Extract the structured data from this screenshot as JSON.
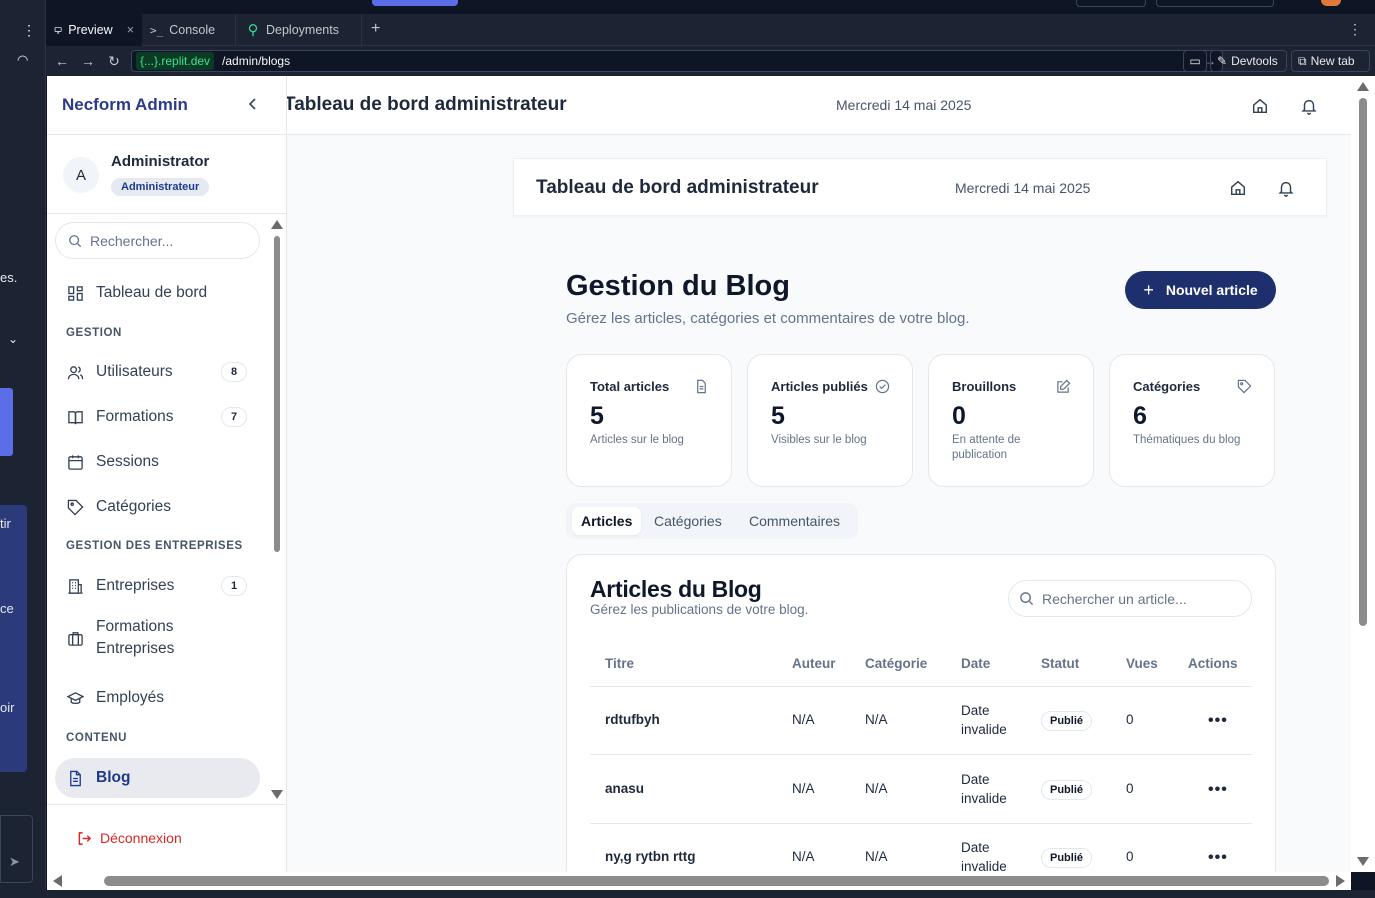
{
  "host": {
    "tabs": [
      {
        "label": "Preview",
        "icon": "monitor-icon"
      },
      {
        "label": "Console",
        "icon": "terminal-icon"
      },
      {
        "label": "Deployments",
        "icon": "deployments-icon"
      }
    ],
    "url_domain": "{...}.replit.dev",
    "url_path": "/admin/blogs",
    "devtools_label": "Devtools",
    "newtab_label": "New tab",
    "left_fragments": [
      "es.",
      "tir",
      "ce",
      "oir"
    ]
  },
  "sidebar": {
    "brand": "Necform Admin",
    "user": {
      "initial": "A",
      "name": "Administrator",
      "role": "Administrateur"
    },
    "search_placeholder": "Rechercher...",
    "items": [
      {
        "label": "Tableau de bord",
        "icon": "dashboard-icon"
      },
      {
        "section": "GESTION"
      },
      {
        "label": "Utilisateurs",
        "icon": "users-icon",
        "badge": "8"
      },
      {
        "label": "Formations",
        "icon": "book-icon",
        "badge": "7"
      },
      {
        "label": "Sessions",
        "icon": "calendar-icon"
      },
      {
        "label": "Catégories",
        "icon": "tag-icon"
      },
      {
        "section": "GESTION DES ENTREPRISES"
      },
      {
        "label": "Entreprises",
        "icon": "building-icon",
        "badge": "1"
      },
      {
        "label": "Formations Entreprises",
        "icon": "briefcase-icon"
      },
      {
        "label": "Employés",
        "icon": "graduation-cap-icon"
      },
      {
        "section": "CONTENU"
      },
      {
        "label": "Blog",
        "icon": "file-icon",
        "active": true
      }
    ],
    "logout": "Déconnexion"
  },
  "header": {
    "title": "Tableau de bord administrateur",
    "date": "Mercredi 14 mai 2025"
  },
  "inner_header": {
    "title": "Tableau de bord administrateur",
    "date": "Mercredi 14 mai 2025"
  },
  "page": {
    "title": "Gestion du Blog",
    "subtitle": "Gérez les articles, catégories et commentaires de votre blog.",
    "new_button": "Nouvel article"
  },
  "stats": [
    {
      "label": "Total articles",
      "value": "5",
      "desc": "Articles sur le blog",
      "icon": "document-icon"
    },
    {
      "label": "Articles publiés",
      "value": "5",
      "desc": "Visibles sur le blog",
      "icon": "check-circle-icon"
    },
    {
      "label": "Brouillons",
      "value": "0",
      "desc": "En attente de publication",
      "icon": "edit-icon"
    },
    {
      "label": "Catégories",
      "value": "6",
      "desc": "Thématiques du blog",
      "icon": "tag-icon"
    }
  ],
  "tabs": [
    "Articles",
    "Catégories",
    "Commentaires"
  ],
  "table": {
    "title": "Articles du Blog",
    "subtitle": "Gérez les publications de votre blog.",
    "search_placeholder": "Rechercher un article...",
    "columns": [
      "Titre",
      "Auteur",
      "Catégorie",
      "Date",
      "Statut",
      "Vues",
      "Actions"
    ],
    "rows": [
      {
        "title": "rdtufbyh",
        "author": "N/A",
        "category": "N/A",
        "date1": "Date",
        "date2": "invalide",
        "status": "Publié",
        "views": "0"
      },
      {
        "title": "anasu",
        "author": "N/A",
        "category": "N/A",
        "date1": "Date",
        "date2": "invalide",
        "status": "Publié",
        "views": "0"
      },
      {
        "title": "ny,g rytbn rttg",
        "author": "N/A",
        "category": "N/A",
        "date1": "Date",
        "date2": "invalide",
        "status": "Publié",
        "views": "0"
      }
    ],
    "actions_glyph": "•••"
  }
}
